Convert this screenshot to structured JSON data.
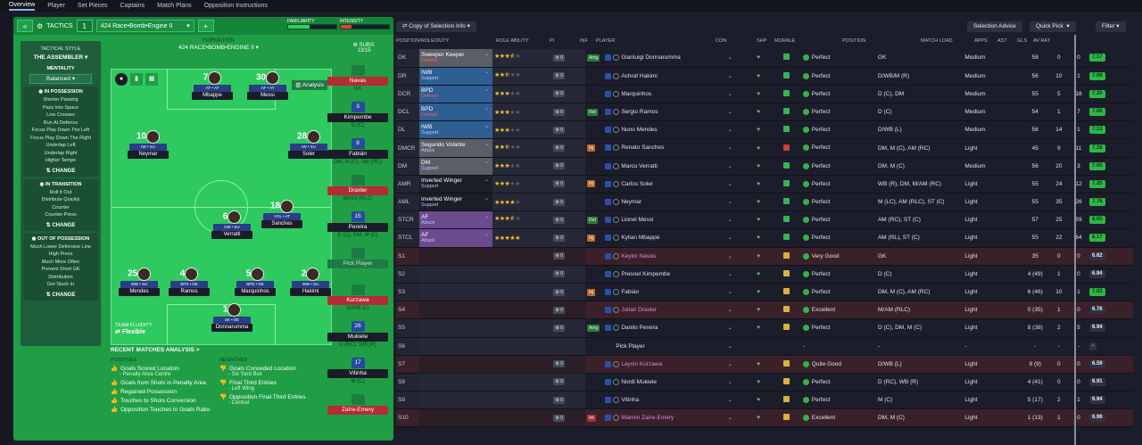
{
  "nav": {
    "tabs": [
      "Overview",
      "Player",
      "Set Pieces",
      "Captains",
      "Match Plans",
      "Opposition Instructions"
    ],
    "active": 0
  },
  "tactics": {
    "label": "TACTICS",
    "slot": "1",
    "name": "424 Race•Bomb•Engine II",
    "familiarity_label": "FAMILIARITY",
    "intensity_label": "INTENSITY",
    "familiarity": 0.45,
    "intensity": 0.22
  },
  "sidebar": {
    "style_label": "TACTICAL STYLE",
    "style": "THE ASSEMBLER",
    "mentality_label": "MENTALITY",
    "mentality": "Balanced",
    "in_possession": {
      "title": "IN POSSESSION",
      "items": [
        "Shorter Passing",
        "Pass Into Space",
        "Low Crosses",
        "Run At Defence",
        "Focus Play Down The Left",
        "Focus Play Down The Right",
        "Underlap Left",
        "Underlap Right",
        "Higher Tempo"
      ]
    },
    "in_transition": {
      "title": "IN TRANSITION",
      "items": [
        "Roll It Out",
        "Distribute Quickly",
        "Counter",
        "Counter-Press"
      ]
    },
    "out_possession": {
      "title": "OUT OF POSSESSION",
      "items": [
        "Much Lower Defensive Line",
        "High Press",
        "Much More Often",
        "Prevent Short GK",
        "Distribution",
        "Get Stuck In"
      ]
    },
    "change": "CHANGE"
  },
  "formation": {
    "label": "FORMATION",
    "name": "424 RACE•BOMB•ENGINE II",
    "analysis": "Analysis",
    "fluidity_label": "TEAM FLUIDITY",
    "fluidity": "Flexible"
  },
  "pitch_players": [
    {
      "num": "7",
      "role": "AF • AT",
      "name": "Mbappe"
    },
    {
      "num": "30",
      "role": "AF • AT",
      "name": "Messi"
    },
    {
      "num": "10",
      "role": "IW • SU",
      "name": "Neymar"
    },
    {
      "num": "28",
      "role": "IW • SU",
      "name": "Soler"
    },
    {
      "num": "6",
      "role": "DM • SU",
      "name": "Verratti"
    },
    {
      "num": "18",
      "role": "VOL • AT",
      "name": "Sanches"
    },
    {
      "num": "25",
      "role": "IWB • SU",
      "name": "Mendes"
    },
    {
      "num": "4",
      "role": "BPD • DE",
      "name": "Ramos"
    },
    {
      "num": "5",
      "role": "BPD • DE",
      "name": "Marquinhos"
    },
    {
      "num": "2",
      "role": "IWB • SU",
      "name": "Hakimi"
    },
    {
      "num": "1",
      "role": "SK • DE",
      "name": "Donnarumma"
    }
  ],
  "subs": {
    "label": "SUBS:",
    "count": "13/15",
    "list": [
      {
        "num": "",
        "name": "Navas",
        "pos": "GK",
        "red": true
      },
      {
        "num": "3",
        "name": "Kimpembe",
        "pos": "D (C)",
        "red": false
      },
      {
        "num": "8",
        "name": "Fabián",
        "pos": "DM, M (C), AM (RC)",
        "red": false
      },
      {
        "num": "",
        "name": "Draxler",
        "pos": "M/AM (RLC)",
        "red": true
      },
      {
        "num": "15",
        "name": "Pereira",
        "pos": "D (C), DM, M (C)",
        "red": false
      },
      {
        "num": "",
        "name": "Pick Player",
        "pos": "",
        "red": false,
        "empty": true
      },
      {
        "num": "",
        "name": "Kurzawa",
        "pos": "D/WB (L)",
        "red": true
      },
      {
        "num": "26",
        "name": "Mukiele",
        "pos": "D (RC), WB (R)",
        "red": false
      },
      {
        "num": "17",
        "name": "Vitinha",
        "pos": "M (C)",
        "red": false
      },
      {
        "num": "",
        "name": "Zaïre-Emery",
        "pos": "",
        "red": true
      }
    ]
  },
  "analysis": {
    "title": "RECENT MATCHES ANALYSIS >",
    "positives_label": "POSITIVES",
    "negatives_label": "NEGATIVES",
    "positives": [
      [
        "Goals Scored Location",
        "- Penalty Area Centre"
      ],
      [
        "Goals from Shots in Penalty Area",
        ""
      ],
      [
        "Regained Possession",
        ""
      ],
      [
        "Touches to Shots Conversion",
        ""
      ],
      [
        "Opposition Touches to Goals Ratio",
        ""
      ]
    ],
    "negatives": [
      [
        "Goals Conceded Location",
        "- Six Yard Box"
      ],
      [
        "Final Third Entries",
        "- Left Wing"
      ],
      [
        "Opposition Final Third Entries",
        "- Central"
      ]
    ]
  },
  "right": {
    "copy_btn": "Copy of Selection Info",
    "selection_advice": "Selection Advice",
    "quick_pick": "Quick Pick",
    "filter": "Filter",
    "columns": [
      "POSITION/ROLE/DUTY",
      "ROLE ABILITY",
      "PI",
      "INF",
      "PLAYER",
      "CON",
      "SHP",
      "MORALE",
      "POSITION",
      "MATCH LOAD",
      "APPS",
      "AST",
      "GLS",
      "AV RAT"
    ]
  },
  "rows": [
    {
      "pos": "GK",
      "role": "Sweeper Keeper",
      "duty": "Defend",
      "dc": "r",
      "stars": 3.5,
      "inf": "Amg",
      "infc": "g",
      "player": "Gianluigi Donnarumma",
      "shp": "g",
      "morale": "Perfect",
      "position": "GK",
      "load": "Medium",
      "apps": "58",
      "ast": "0",
      "gls": "0",
      "rat": "7.17",
      "ratg": true,
      "roleColor": "#5b5e66"
    },
    {
      "pos": "DR",
      "role": "IWB",
      "duty": "Support",
      "dc": "b",
      "stars": 2.5,
      "inf": "",
      "player": "Achraf Hakimi",
      "shp": "g",
      "morale": "Perfect",
      "position": "D/WB/M (R)",
      "load": "Medium",
      "apps": "56",
      "ast": "10",
      "gls": "1",
      "rat": "7.09",
      "ratg": true,
      "roleColor": "#2f5e93"
    },
    {
      "pos": "DCR",
      "role": "BPD",
      "duty": "Defend",
      "dc": "r",
      "stars": 3,
      "inf": "",
      "player": "Marquinhos",
      "shp": "g",
      "morale": "Perfect",
      "position": "D (C), DM",
      "load": "Medium",
      "apps": "55",
      "ast": "5",
      "gls": "18",
      "rat": "7.20",
      "ratg": true,
      "roleColor": "#2f5e93"
    },
    {
      "pos": "DCL",
      "role": "BPD",
      "duty": "Defend",
      "dc": "r",
      "stars": 3,
      "inf": "Ret",
      "infc": "g",
      "player": "Sergio Ramos",
      "shp": "g",
      "morale": "Perfect",
      "position": "D (C)",
      "load": "Medium",
      "apps": "54",
      "ast": "1",
      "gls": "7",
      "rat": "7.06",
      "ratg": true,
      "roleColor": "#2f5e93"
    },
    {
      "pos": "DL",
      "role": "IWB",
      "duty": "Support",
      "dc": "b",
      "stars": 3,
      "inf": "",
      "player": "Nuno Mendes",
      "shp": "g",
      "morale": "Perfect",
      "position": "D/WB (L)",
      "load": "Medium",
      "apps": "56",
      "ast": "14",
      "gls": "1",
      "rat": "7.13",
      "ratg": true,
      "roleColor": "#2f5e93"
    },
    {
      "pos": "DMCR",
      "role": "Segundo Volante",
      "duty": "Attack",
      "dc": "b",
      "stars": 2.5,
      "inf": "Inj",
      "infc": "o",
      "player": "Renato Sanches",
      "shp": "r",
      "morale": "Perfect",
      "position": "DM, M (C), AM (RC)",
      "load": "Light",
      "apps": "45",
      "ast": "9",
      "gls": "11",
      "rat": "7.28",
      "ratg": true,
      "roleColor": "#5b5e66"
    },
    {
      "pos": "DM",
      "role": "DM",
      "duty": "Support",
      "dc": "b",
      "stars": 3,
      "inf": "",
      "player": "Marco Verratti",
      "shp": "g",
      "morale": "Perfect",
      "position": "DM, M (C)",
      "load": "Medium",
      "apps": "56",
      "ast": "20",
      "gls": "3",
      "rat": "7.00",
      "ratg": true,
      "roleColor": "#5b5e66"
    },
    {
      "pos": "AMR",
      "role": "Inverted Winger",
      "duty": "Support",
      "dc": "b",
      "stars": 3,
      "inf": "Inj",
      "infc": "o",
      "player": "Carlos Soler",
      "shp": "g",
      "morale": "Perfect",
      "position": "WB (R), DM, M/AM (RC)",
      "load": "Light",
      "apps": "55",
      "ast": "24",
      "gls": "12",
      "rat": "7.25",
      "ratg": true,
      "roleColor": "#1b1d27"
    },
    {
      "pos": "AML",
      "role": "Inverted Winger",
      "duty": "Support",
      "dc": "b",
      "stars": 4,
      "inf": "",
      "player": "Neymar",
      "shp": "g",
      "morale": "Perfect",
      "position": "M (LC), AM (RLC), ST (C)",
      "load": "Light",
      "apps": "55",
      "ast": "35",
      "gls": "26",
      "rat": "7.76",
      "ratg": true,
      "roleColor": "#1b1d27"
    },
    {
      "pos": "STCR",
      "role": "AF",
      "duty": "Attack",
      "dc": "b",
      "stars": 3.5,
      "inf": "Ret",
      "infc": "g",
      "player": "Lionel Messi",
      "shp": "g",
      "morale": "Perfect",
      "position": "AM (RC), ST (C)",
      "load": "Light",
      "apps": "57",
      "ast": "25",
      "gls": "59",
      "rat": "8.05",
      "ratg": true,
      "roleColor": "#6b4a8e"
    },
    {
      "pos": "STCL",
      "role": "AF",
      "duty": "Attack",
      "dc": "b",
      "stars": 5,
      "inf": "Inj",
      "infc": "o",
      "player": "Kylian Mbappé",
      "shp": "g",
      "morale": "Perfect",
      "position": "AM (RL), ST (C)",
      "load": "Light",
      "apps": "55",
      "ast": "22",
      "gls": "64",
      "rat": "8.17",
      "ratg": true,
      "roleColor": "#6b4a8e"
    },
    {
      "pos": "S1",
      "red": true,
      "player": "Keylor Navas",
      "shp": "y",
      "morale": "Very Good",
      "position": "GK",
      "load": "Light",
      "apps": "35",
      "ast": "0",
      "gls": "0",
      "rat": "6.62"
    },
    {
      "pos": "S2",
      "player": "Presnel Kimpembe",
      "shp": "y",
      "morale": "Perfect",
      "position": "D (C)",
      "load": "Light",
      "apps": "4 (49)",
      "ast": "1",
      "gls": "0",
      "rat": "6.94"
    },
    {
      "pos": "S3",
      "inf": "Inj",
      "infc": "o",
      "player": "Fabián",
      "shp": "y",
      "morale": "Perfect",
      "position": "DM, M (C), AM (RC)",
      "load": "Light",
      "apps": "6 (46)",
      "ast": "10",
      "gls": "1",
      "rat": "7.03",
      "ratg": true
    },
    {
      "pos": "S4",
      "red": true,
      "player": "Julian Draxler",
      "shp": "y",
      "morale": "Excellent",
      "position": "M/AM (RLC)",
      "load": "Light",
      "apps": "0 (35)",
      "ast": "1",
      "gls": "0",
      "rat": "6.76"
    },
    {
      "pos": "S5",
      "inf": "Amg",
      "infc": "g",
      "player": "Danilo Pereira",
      "shp": "y",
      "morale": "Perfect",
      "position": "D (C), DM, M (C)",
      "load": "Light",
      "apps": "8 (38)",
      "ast": "2",
      "gls": "5",
      "rat": "6.94"
    },
    {
      "pos": "S6",
      "player": "Pick Player",
      "empty": true,
      "morale": "-",
      "position": "-",
      "load": "-",
      "apps": "-",
      "ast": "-",
      "gls": "-",
      "rat": "-"
    },
    {
      "pos": "S7",
      "red": true,
      "player": "Layvin Kurzawa",
      "shp": "y",
      "morale": "Quite Good",
      "position": "D/WB (L)",
      "load": "Light",
      "apps": "8 (9)",
      "ast": "0",
      "gls": "0",
      "rat": "6.59"
    },
    {
      "pos": "S8",
      "player": "Nordi Mukiele",
      "shp": "y",
      "morale": "Perfect",
      "position": "D (RC), WB (R)",
      "load": "Light",
      "apps": "4 (41)",
      "ast": "0",
      "gls": "0",
      "rat": "6.91"
    },
    {
      "pos": "S9",
      "player": "Vitinha",
      "shp": "y",
      "morale": "Perfect",
      "position": "M (C)",
      "load": "Light",
      "apps": "5 (17)",
      "ast": "2",
      "gls": "1",
      "rat": "6.94"
    },
    {
      "pos": "S10",
      "red": true,
      "inf": "Int",
      "infc": "r",
      "player": "Warren Zaïre-Emery",
      "shp": "y",
      "morale": "Excellent",
      "position": "DM, M (C)",
      "load": "Light",
      "apps": "1 (13)",
      "ast": "1",
      "gls": "0",
      "rat": "6.96"
    }
  ]
}
